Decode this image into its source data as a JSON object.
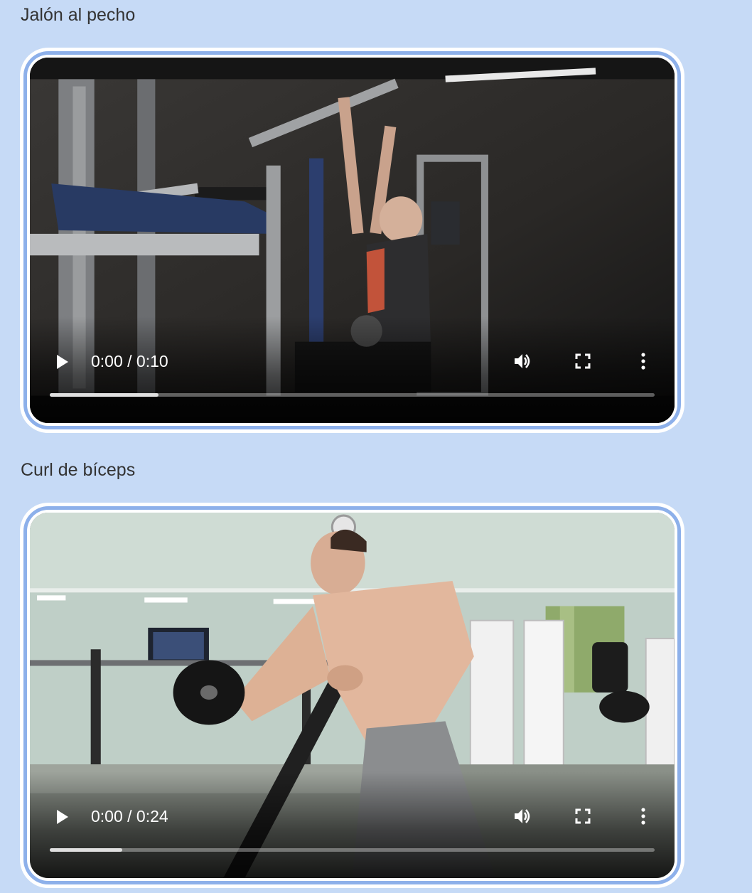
{
  "exercises": [
    {
      "title": "Jalón al pecho",
      "video": {
        "time_display": "0:00 / 0:10",
        "progress_fraction": 0.18
      }
    },
    {
      "title": "Curl de bíceps",
      "video": {
        "time_display": "0:00 / 0:24",
        "progress_fraction": 0.12
      }
    }
  ],
  "icons": {
    "play": "play-icon",
    "volume": "volume-icon",
    "fullscreen": "fullscreen-icon",
    "more": "more-options-icon"
  },
  "colors": {
    "page_background": "#c6daf6",
    "frame_accent": "#8db0ea",
    "frame_border": "#ffffff",
    "title_text": "#333333"
  }
}
